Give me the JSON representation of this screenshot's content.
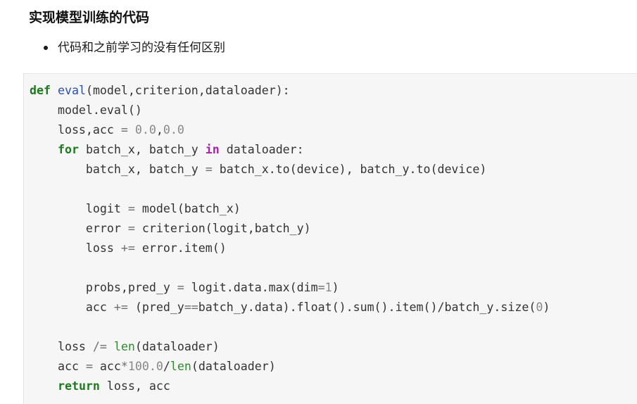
{
  "heading": "实现模型训练的代码",
  "bullets": [
    "代码和之前学习的没有任何区别"
  ],
  "code_language": "python",
  "code_lines": [
    [
      {
        "t": "def",
        "c": "kw"
      },
      {
        "t": " "
      },
      {
        "t": "eval",
        "c": "fn"
      },
      {
        "t": "(model,criterion,dataloader):"
      }
    ],
    [
      {
        "t": "    model.eval()"
      }
    ],
    [
      {
        "t": "    loss,acc "
      },
      {
        "t": "=",
        "c": "op"
      },
      {
        "t": " "
      },
      {
        "t": "0.0",
        "c": "num"
      },
      {
        "t": ","
      },
      {
        "t": "0.0",
        "c": "num"
      }
    ],
    [
      {
        "t": "    "
      },
      {
        "t": "for",
        "c": "kw"
      },
      {
        "t": " batch_x, batch_y "
      },
      {
        "t": "in",
        "c": "kw2"
      },
      {
        "t": " dataloader:"
      }
    ],
    [
      {
        "t": "        batch_x, batch_y "
      },
      {
        "t": "=",
        "c": "op"
      },
      {
        "t": " batch_x.to(device), batch_y.to(device)"
      }
    ],
    [
      {
        "t": ""
      }
    ],
    [
      {
        "t": "        logit "
      },
      {
        "t": "=",
        "c": "op"
      },
      {
        "t": " model(batch_x)"
      }
    ],
    [
      {
        "t": "        error "
      },
      {
        "t": "=",
        "c": "op"
      },
      {
        "t": " criterion(logit,batch_y)"
      }
    ],
    [
      {
        "t": "        loss "
      },
      {
        "t": "+=",
        "c": "op"
      },
      {
        "t": " error.item()"
      }
    ],
    [
      {
        "t": ""
      }
    ],
    [
      {
        "t": "        probs,pred_y "
      },
      {
        "t": "=",
        "c": "op"
      },
      {
        "t": " logit.data.max(dim"
      },
      {
        "t": "=",
        "c": "op"
      },
      {
        "t": "1",
        "c": "num"
      },
      {
        "t": ")"
      }
    ],
    [
      {
        "t": "        acc "
      },
      {
        "t": "+=",
        "c": "op"
      },
      {
        "t": " (pred_y"
      },
      {
        "t": "==",
        "c": "op"
      },
      {
        "t": "batch_y.data).float().sum().item()/batch_y.size("
      },
      {
        "t": "0",
        "c": "num"
      },
      {
        "t": ")"
      }
    ],
    [
      {
        "t": ""
      }
    ],
    [
      {
        "t": "    loss "
      },
      {
        "t": "/=",
        "c": "op"
      },
      {
        "t": " "
      },
      {
        "t": "len",
        "c": "builtin"
      },
      {
        "t": "(dataloader)"
      }
    ],
    [
      {
        "t": "    acc "
      },
      {
        "t": "=",
        "c": "op"
      },
      {
        "t": " acc"
      },
      {
        "t": "*",
        "c": "op"
      },
      {
        "t": "100.0",
        "c": "num"
      },
      {
        "t": "/"
      },
      {
        "t": "len",
        "c": "builtin"
      },
      {
        "t": "(dataloader)"
      }
    ],
    [
      {
        "t": "    "
      },
      {
        "t": "return",
        "c": "kw"
      },
      {
        "t": " loss, acc"
      }
    ]
  ]
}
